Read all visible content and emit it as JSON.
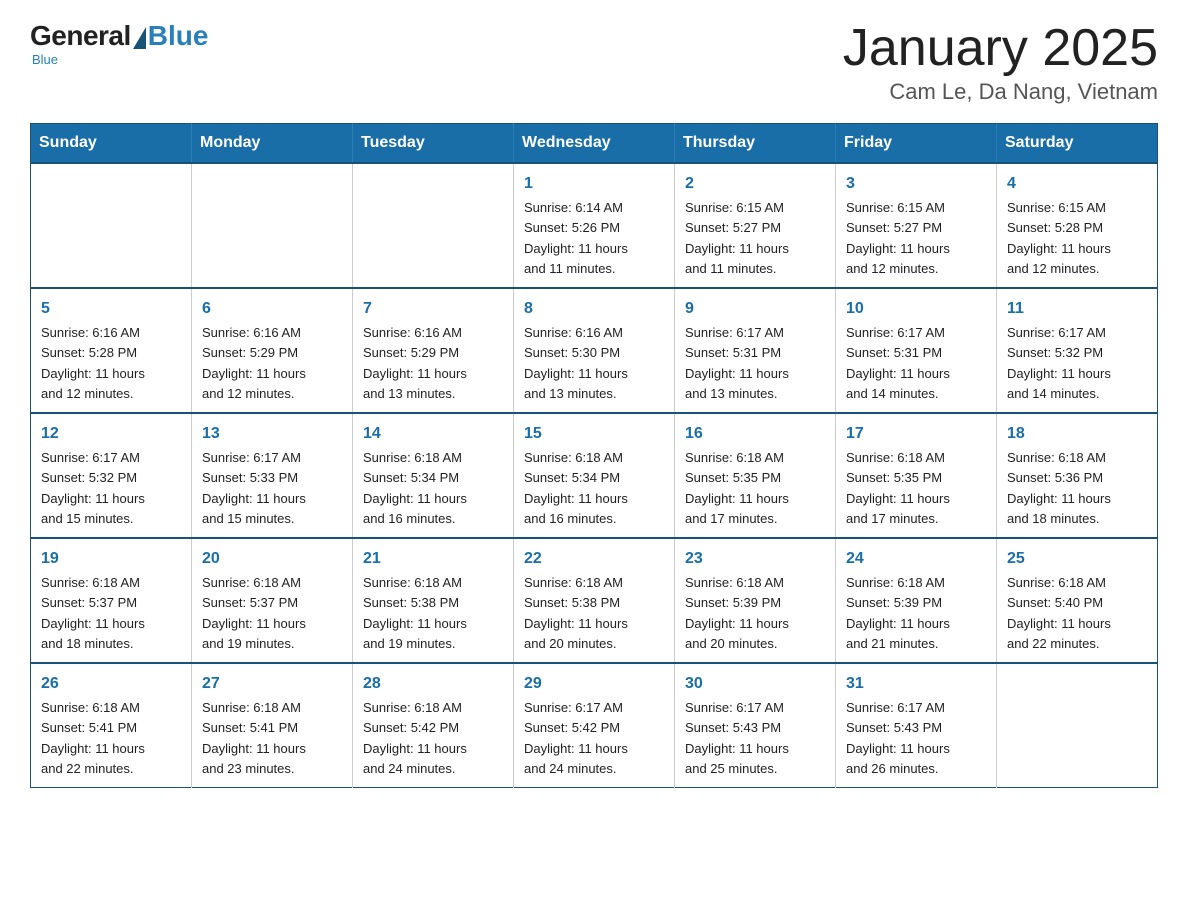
{
  "logo": {
    "general": "General",
    "blue": "Blue",
    "subtitle": "Blue"
  },
  "title": "January 2025",
  "location": "Cam Le, Da Nang, Vietnam",
  "days_of_week": [
    "Sunday",
    "Monday",
    "Tuesday",
    "Wednesday",
    "Thursday",
    "Friday",
    "Saturday"
  ],
  "weeks": [
    [
      {
        "day": "",
        "info": ""
      },
      {
        "day": "",
        "info": ""
      },
      {
        "day": "",
        "info": ""
      },
      {
        "day": "1",
        "info": "Sunrise: 6:14 AM\nSunset: 5:26 PM\nDaylight: 11 hours\nand 11 minutes."
      },
      {
        "day": "2",
        "info": "Sunrise: 6:15 AM\nSunset: 5:27 PM\nDaylight: 11 hours\nand 11 minutes."
      },
      {
        "day": "3",
        "info": "Sunrise: 6:15 AM\nSunset: 5:27 PM\nDaylight: 11 hours\nand 12 minutes."
      },
      {
        "day": "4",
        "info": "Sunrise: 6:15 AM\nSunset: 5:28 PM\nDaylight: 11 hours\nand 12 minutes."
      }
    ],
    [
      {
        "day": "5",
        "info": "Sunrise: 6:16 AM\nSunset: 5:28 PM\nDaylight: 11 hours\nand 12 minutes."
      },
      {
        "day": "6",
        "info": "Sunrise: 6:16 AM\nSunset: 5:29 PM\nDaylight: 11 hours\nand 12 minutes."
      },
      {
        "day": "7",
        "info": "Sunrise: 6:16 AM\nSunset: 5:29 PM\nDaylight: 11 hours\nand 13 minutes."
      },
      {
        "day": "8",
        "info": "Sunrise: 6:16 AM\nSunset: 5:30 PM\nDaylight: 11 hours\nand 13 minutes."
      },
      {
        "day": "9",
        "info": "Sunrise: 6:17 AM\nSunset: 5:31 PM\nDaylight: 11 hours\nand 13 minutes."
      },
      {
        "day": "10",
        "info": "Sunrise: 6:17 AM\nSunset: 5:31 PM\nDaylight: 11 hours\nand 14 minutes."
      },
      {
        "day": "11",
        "info": "Sunrise: 6:17 AM\nSunset: 5:32 PM\nDaylight: 11 hours\nand 14 minutes."
      }
    ],
    [
      {
        "day": "12",
        "info": "Sunrise: 6:17 AM\nSunset: 5:32 PM\nDaylight: 11 hours\nand 15 minutes."
      },
      {
        "day": "13",
        "info": "Sunrise: 6:17 AM\nSunset: 5:33 PM\nDaylight: 11 hours\nand 15 minutes."
      },
      {
        "day": "14",
        "info": "Sunrise: 6:18 AM\nSunset: 5:34 PM\nDaylight: 11 hours\nand 16 minutes."
      },
      {
        "day": "15",
        "info": "Sunrise: 6:18 AM\nSunset: 5:34 PM\nDaylight: 11 hours\nand 16 minutes."
      },
      {
        "day": "16",
        "info": "Sunrise: 6:18 AM\nSunset: 5:35 PM\nDaylight: 11 hours\nand 17 minutes."
      },
      {
        "day": "17",
        "info": "Sunrise: 6:18 AM\nSunset: 5:35 PM\nDaylight: 11 hours\nand 17 minutes."
      },
      {
        "day": "18",
        "info": "Sunrise: 6:18 AM\nSunset: 5:36 PM\nDaylight: 11 hours\nand 18 minutes."
      }
    ],
    [
      {
        "day": "19",
        "info": "Sunrise: 6:18 AM\nSunset: 5:37 PM\nDaylight: 11 hours\nand 18 minutes."
      },
      {
        "day": "20",
        "info": "Sunrise: 6:18 AM\nSunset: 5:37 PM\nDaylight: 11 hours\nand 19 minutes."
      },
      {
        "day": "21",
        "info": "Sunrise: 6:18 AM\nSunset: 5:38 PM\nDaylight: 11 hours\nand 19 minutes."
      },
      {
        "day": "22",
        "info": "Sunrise: 6:18 AM\nSunset: 5:38 PM\nDaylight: 11 hours\nand 20 minutes."
      },
      {
        "day": "23",
        "info": "Sunrise: 6:18 AM\nSunset: 5:39 PM\nDaylight: 11 hours\nand 20 minutes."
      },
      {
        "day": "24",
        "info": "Sunrise: 6:18 AM\nSunset: 5:39 PM\nDaylight: 11 hours\nand 21 minutes."
      },
      {
        "day": "25",
        "info": "Sunrise: 6:18 AM\nSunset: 5:40 PM\nDaylight: 11 hours\nand 22 minutes."
      }
    ],
    [
      {
        "day": "26",
        "info": "Sunrise: 6:18 AM\nSunset: 5:41 PM\nDaylight: 11 hours\nand 22 minutes."
      },
      {
        "day": "27",
        "info": "Sunrise: 6:18 AM\nSunset: 5:41 PM\nDaylight: 11 hours\nand 23 minutes."
      },
      {
        "day": "28",
        "info": "Sunrise: 6:18 AM\nSunset: 5:42 PM\nDaylight: 11 hours\nand 24 minutes."
      },
      {
        "day": "29",
        "info": "Sunrise: 6:17 AM\nSunset: 5:42 PM\nDaylight: 11 hours\nand 24 minutes."
      },
      {
        "day": "30",
        "info": "Sunrise: 6:17 AM\nSunset: 5:43 PM\nDaylight: 11 hours\nand 25 minutes."
      },
      {
        "day": "31",
        "info": "Sunrise: 6:17 AM\nSunset: 5:43 PM\nDaylight: 11 hours\nand 26 minutes."
      },
      {
        "day": "",
        "info": ""
      }
    ]
  ]
}
